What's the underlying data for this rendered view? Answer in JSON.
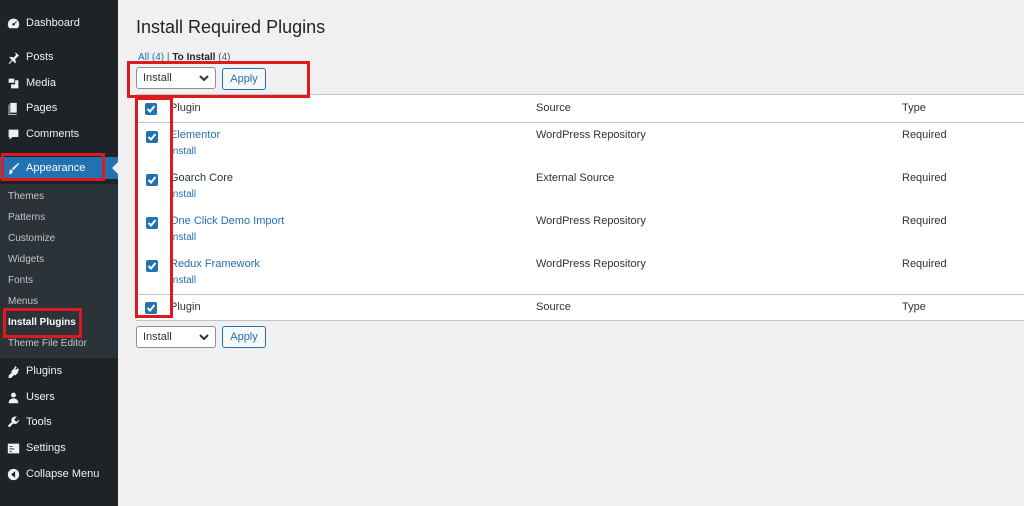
{
  "sidebar": {
    "items": [
      {
        "label": "Dashboard",
        "icon": "dashboard-icon"
      },
      {
        "label": "Posts",
        "icon": "pin-icon"
      },
      {
        "label": "Media",
        "icon": "media-icon"
      },
      {
        "label": "Pages",
        "icon": "pages-icon"
      },
      {
        "label": "Comments",
        "icon": "comment-icon"
      },
      {
        "label": "Appearance",
        "icon": "brush-icon"
      },
      {
        "label": "Plugins",
        "icon": "plug-icon"
      },
      {
        "label": "Users",
        "icon": "user-icon"
      },
      {
        "label": "Tools",
        "icon": "wrench-icon"
      },
      {
        "label": "Settings",
        "icon": "settings-icon"
      },
      {
        "label": "Collapse Menu",
        "icon": "collapse-icon"
      }
    ],
    "submenu": [
      "Themes",
      "Patterns",
      "Customize",
      "Widgets",
      "Fonts",
      "Menus",
      "Install Plugins",
      "Theme File Editor"
    ],
    "colors": {
      "background": "#1d2327",
      "active": "#2271b1",
      "submenu": "#2c3338"
    }
  },
  "main": {
    "title": "Install Required Plugins",
    "views": {
      "all_label": "All",
      "all_count": "(4)",
      "separator": "|",
      "to_install_label": "To Install",
      "to_install_count": "(4)"
    },
    "bulk_action_top": {
      "selected": "Install",
      "apply_label": "Apply"
    },
    "bulk_action_bottom": {
      "selected": "Install",
      "apply_label": "Apply"
    },
    "table": {
      "columns": [
        "Plugin",
        "Source",
        "Type"
      ],
      "rows": [
        {
          "plugin": "Elementor",
          "action": "Install",
          "source": "WordPress Repository",
          "type": "Required",
          "checked": true,
          "linked": true
        },
        {
          "plugin": "Goarch Core",
          "action": "Install",
          "source": "External Source",
          "type": "Required",
          "checked": true,
          "linked": false
        },
        {
          "plugin": "One Click Demo Import",
          "action": "Install",
          "source": "WordPress Repository",
          "type": "Required",
          "checked": true,
          "linked": true
        },
        {
          "plugin": "Redux Framework",
          "action": "Install",
          "source": "WordPress Repository",
          "type": "Required",
          "checked": true,
          "linked": true
        }
      ],
      "select_all_checked": true
    }
  },
  "colors": {
    "accent": "#2271b1",
    "highlight": "#e0191f",
    "background": "#f0f0f1"
  }
}
